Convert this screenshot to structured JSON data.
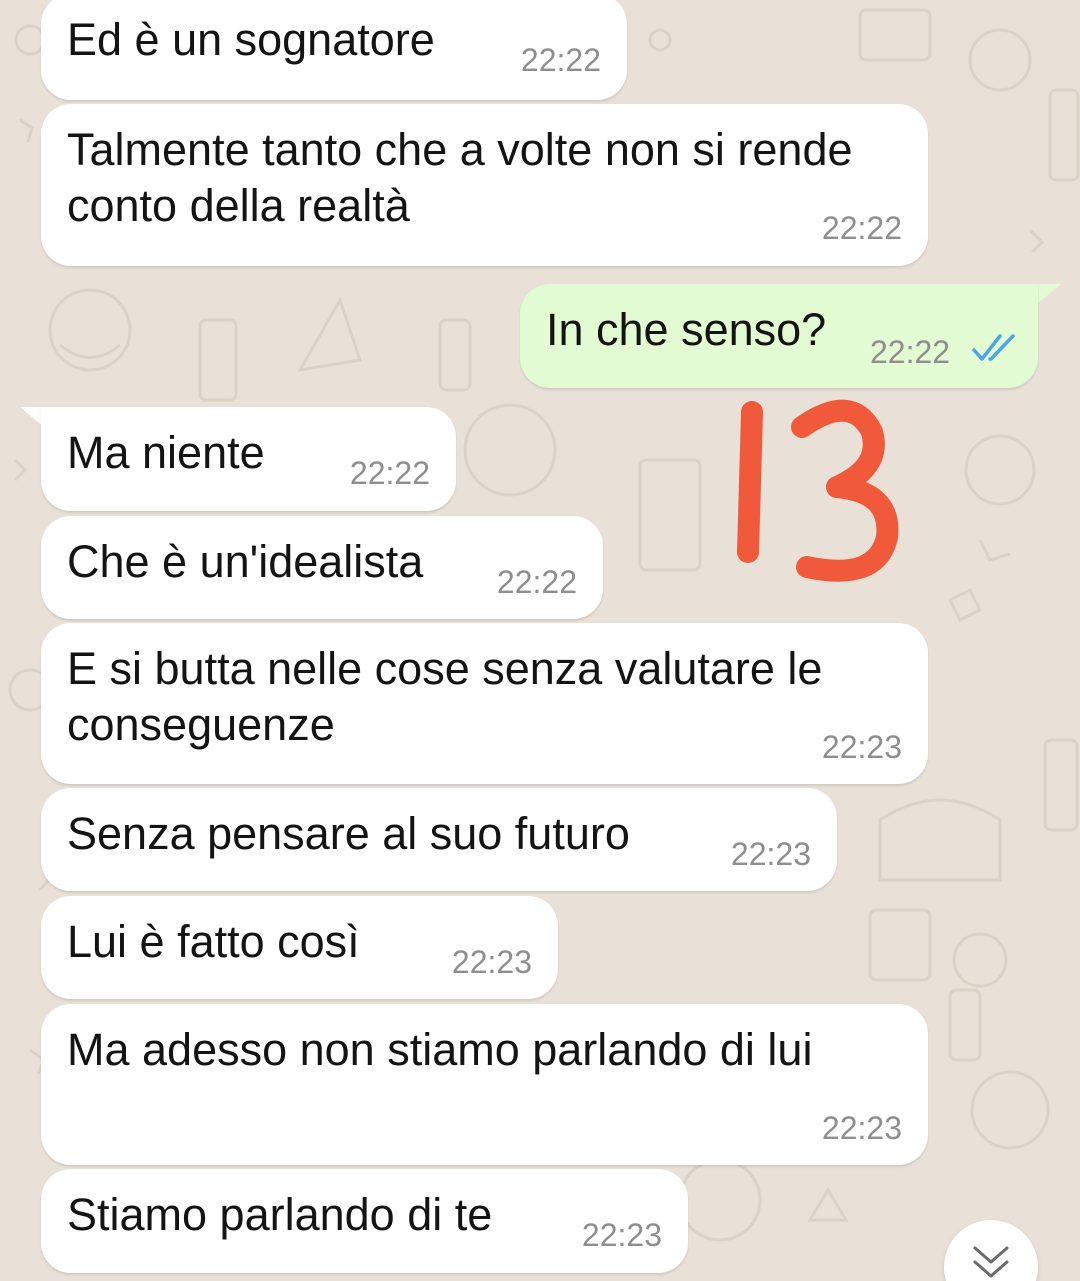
{
  "messages": [
    {
      "text": "Ed è un sognatore",
      "time": "22:22",
      "direction": "incoming"
    },
    {
      "text": "Talmente tanto che a volte non si rende conto della realtà",
      "time": "22:22",
      "direction": "incoming"
    },
    {
      "text": "In che senso?",
      "time": "22:22",
      "direction": "outgoing",
      "status": "read"
    },
    {
      "text": "Ma niente",
      "time": "22:22",
      "direction": "incoming"
    },
    {
      "text": "Che è un'idealista",
      "time": "22:22",
      "direction": "incoming"
    },
    {
      "text": "E si butta nelle cose senza valutare le conseguenze",
      "time": "22:23",
      "direction": "incoming"
    },
    {
      "text": "Senza pensare al suo futuro",
      "time": "22:23",
      "direction": "incoming"
    },
    {
      "text": "Lui è fatto così",
      "time": "22:23",
      "direction": "incoming"
    },
    {
      "text": "Ma adesso non stiamo parlando di lui",
      "time": "22:23",
      "direction": "incoming"
    },
    {
      "text": "Stiamo parlando di te",
      "time": "22:23",
      "direction": "incoming"
    }
  ],
  "annotation": {
    "text": "13",
    "color": "#f05a3a"
  },
  "colors": {
    "wallpaper": "#e9e1d7",
    "incoming_bubble": "#ffffff",
    "outgoing_bubble": "#e2fbd3",
    "timestamp": "#8e8e8e",
    "read_tick": "#4fa6e6"
  },
  "icons": {
    "read_status": "double-check-icon",
    "scroll_down": "double-chevron-down-icon"
  }
}
